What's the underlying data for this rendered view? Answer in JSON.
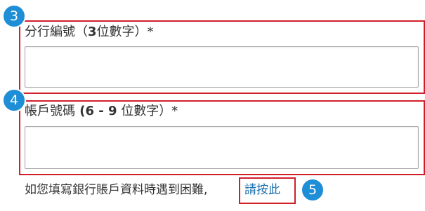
{
  "form": {
    "branch": {
      "label_prefix": "分行編號（",
      "label_bold": "3",
      "label_suffix": "位數字）*",
      "value": "",
      "placeholder": ""
    },
    "account": {
      "label_prefix": "帳戶號碼",
      "label_bold": " (6 - 9",
      "label_suffix": " 位數字）*",
      "value": "",
      "placeholder": ""
    }
  },
  "help": {
    "text": "如您填寫銀行賬戶資料時遇到困難,",
    "link_label": "請按此"
  },
  "badges": {
    "branch": "3",
    "account": "4",
    "link": "5"
  },
  "colors": {
    "highlight_border": "#d01f2a",
    "badge_bg": "#1e8ed6",
    "link": "#1a6fb0",
    "text": "#333333"
  }
}
